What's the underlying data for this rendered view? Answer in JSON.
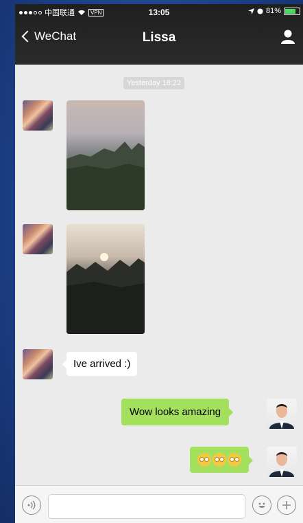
{
  "status_bar": {
    "carrier": "中国联通",
    "vpn": "VPN",
    "time": "13:05",
    "battery": "81%"
  },
  "nav": {
    "back_label": "WeChat",
    "title": "Lissa"
  },
  "chat": {
    "timestamp": "Yesterday 18:22",
    "messages": [
      {
        "from": "Lissa",
        "type": "image",
        "description": "misty karst mountains at dusk"
      },
      {
        "from": "Lissa",
        "type": "image",
        "description": "sunset over mountains"
      },
      {
        "from": "Lissa",
        "type": "text",
        "text": "Ive arrived  :)"
      },
      {
        "from": "me",
        "type": "text",
        "text": "Wow looks amazing"
      },
      {
        "from": "me",
        "type": "emoji",
        "count": 3
      }
    ]
  },
  "colors": {
    "outgoing_bubble": "#a3e05e",
    "incoming_bubble": "#ffffff",
    "background": "#ebebeb",
    "topbar": "#262626"
  },
  "icons": {
    "voice": "voice-mode-icon",
    "emoji": "emoji-icon",
    "plus": "plus-icon",
    "profile": "person-icon"
  }
}
